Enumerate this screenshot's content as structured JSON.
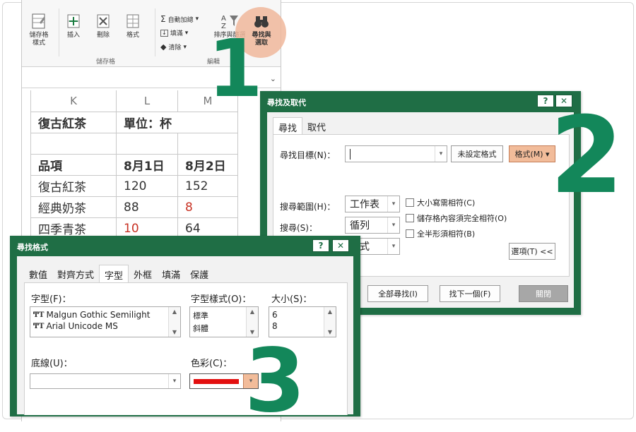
{
  "ribbon": {
    "cell_style": "儲存格\n樣式",
    "insert": "插入",
    "delete": "刪除",
    "format": "格式",
    "cells_group": "儲存格",
    "autosum": "自動加總",
    "fill": "填滿",
    "clear": "清除",
    "sort_filter": "排序與篩選",
    "find_select": "尋找與\n選取",
    "edit_group": "編輯"
  },
  "sheet": {
    "columns": [
      "K",
      "L",
      "M"
    ],
    "title": "復古紅茶",
    "unit": "單位：杯",
    "header": [
      "品項",
      "8月1日",
      "8月2日"
    ],
    "rows": [
      {
        "name": "復古紅茶",
        "d1": "120",
        "d2": "152"
      },
      {
        "name": "經典奶茶",
        "d1": "88",
        "d2": "8"
      },
      {
        "name": "四季青茶",
        "d1": "10",
        "d2": "64"
      }
    ]
  },
  "find_dialog": {
    "title": "尋找及取代",
    "help": "?",
    "close": "✕",
    "tabs": [
      "尋找",
      "取代"
    ],
    "find_what_label": "尋找目標(N)：",
    "no_format": "未設定格式",
    "format_button": "格式(M) ▾",
    "within_label": "搜尋範圍(H)：",
    "within_value": "工作表",
    "search_label": "搜尋(S)：",
    "search_value": "循列",
    "lookin_value": "式",
    "match_case": "大小寫需相符(C)",
    "match_entire": "儲存格內容須完全相符(O)",
    "match_width": "全半形須相符(B)",
    "options": "選項(T) <<",
    "find_all": "全部尋找(I)",
    "find_next": "找下一個(F)",
    "close_btn": "關閉"
  },
  "format_dialog": {
    "title": "尋找格式",
    "help": "?",
    "close": "✕",
    "tabs": [
      "數值",
      "對齊方式",
      "字型",
      "外框",
      "填滿",
      "保護"
    ],
    "font_label": "字型(F)：",
    "fonts": [
      "Malgun Gothic Semilight",
      "Arial Unicode MS"
    ],
    "style_label": "字型樣式(O)：",
    "styles": [
      "標準",
      "斜體"
    ],
    "size_label": "大小(S)：",
    "sizes": [
      "6",
      "8"
    ],
    "underline_label": "底線(U)：",
    "color_label": "色彩(C)："
  },
  "steps": [
    "1",
    "2",
    "3"
  ],
  "colors": {
    "accent": "#1f6e45",
    "step": "#13875a",
    "highlight": "#f0b79b",
    "red": "#e30f0f"
  }
}
